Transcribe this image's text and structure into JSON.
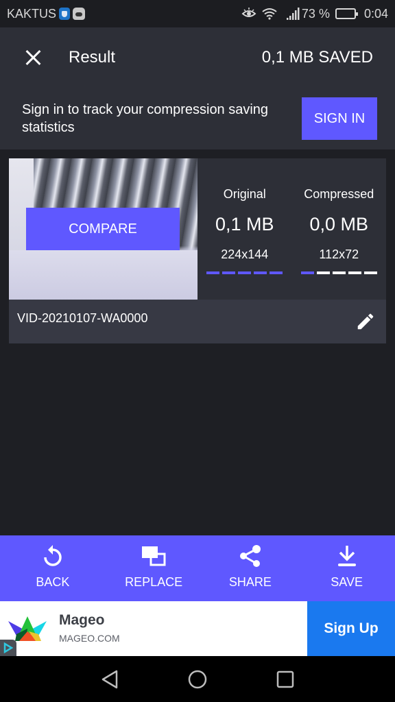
{
  "status_bar": {
    "carrier": "KAKTUS",
    "battery_percent": "73 %",
    "battery_level": 0.73,
    "time": "0:04",
    "icons": [
      "shield-icon",
      "bear-app-icon",
      "eye-icon",
      "wifi-icon",
      "signal-icon",
      "battery-icon"
    ]
  },
  "app_bar": {
    "title": "Result",
    "saved_text": "0,1 MB SAVED",
    "close_icon": "close-icon"
  },
  "signin_banner": {
    "message": "Sign in to track your compression saving statistics",
    "button_label": "SIGN IN"
  },
  "result_card": {
    "compare_label": "COMPARE",
    "original": {
      "label": "Original",
      "size": "0,1 MB",
      "dimensions": "224x144",
      "level_segments_filled": 5,
      "level_segments_total": 5
    },
    "compressed": {
      "label": "Compressed",
      "size": "0,0 MB",
      "dimensions": "112x72",
      "level_segments_filled": 1,
      "level_segments_total": 5
    },
    "file_name": "VID-20210107-WA0000",
    "edit_icon": "pencil-icon"
  },
  "actions": [
    {
      "label": "BACK",
      "icon": "undo-icon"
    },
    {
      "label": "REPLACE",
      "icon": "replace-icon"
    },
    {
      "label": "SHARE",
      "icon": "share-icon"
    },
    {
      "label": "SAVE",
      "icon": "download-icon"
    }
  ],
  "ad": {
    "title": "Mageo",
    "domain": "MAGEO.COM",
    "cta_label": "Sign Up"
  },
  "nav_bar": {
    "buttons": [
      "back-triangle-icon",
      "home-circle-icon",
      "recents-square-icon"
    ]
  },
  "colors": {
    "accent": "#5f58ff",
    "header_bg": "#2d2f37",
    "page_bg": "#1e1f24",
    "ad_cta": "#1a79ef"
  }
}
